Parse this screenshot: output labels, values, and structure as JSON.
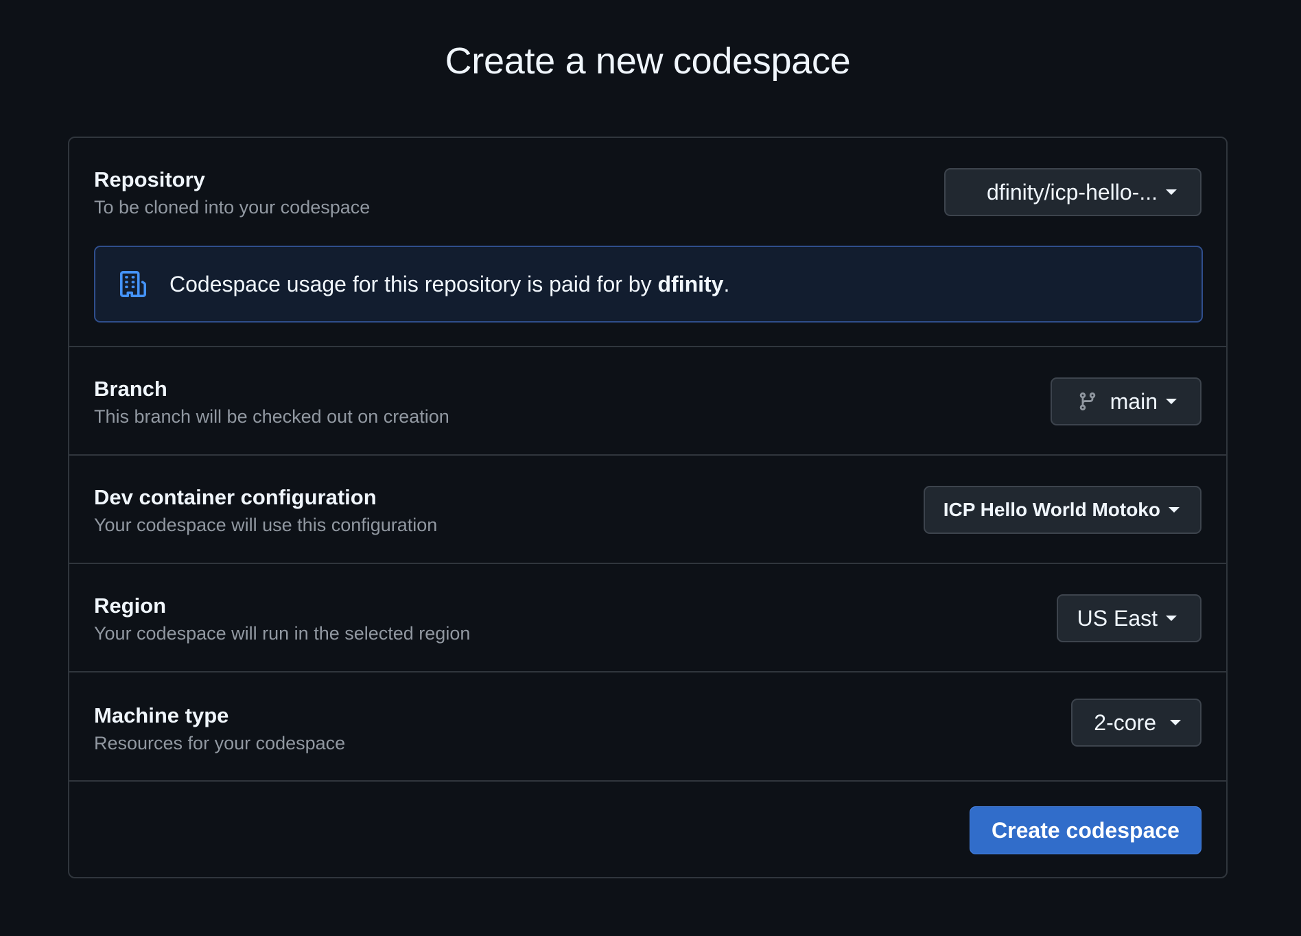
{
  "page": {
    "title": "Create a new codespace"
  },
  "repository": {
    "label": "Repository",
    "description": "To be cloned into your codespace",
    "selected": "dfinity/icp-hello-...",
    "notice_prefix": "Codespace usage for this repository is paid for by ",
    "notice_owner": "dfinity",
    "notice_suffix": ".",
    "notice_icon": "organization-icon"
  },
  "branch": {
    "label": "Branch",
    "description": "This branch will be checked out on creation",
    "selected": "main",
    "icon": "git-branch-icon"
  },
  "devcontainer": {
    "label": "Dev container configuration",
    "description": "Your codespace will use this configuration",
    "selected": "ICP Hello World Motoko"
  },
  "region": {
    "label": "Region",
    "description": "Your codespace will run in the selected region",
    "selected": "US East"
  },
  "machine": {
    "label": "Machine type",
    "description": "Resources for your codespace",
    "selected": "2-core"
  },
  "actions": {
    "create_label": "Create codespace"
  },
  "colors": {
    "background": "#0d1117",
    "border": "#30363d",
    "accent": "#316dca",
    "muted_text": "#9198a1"
  }
}
